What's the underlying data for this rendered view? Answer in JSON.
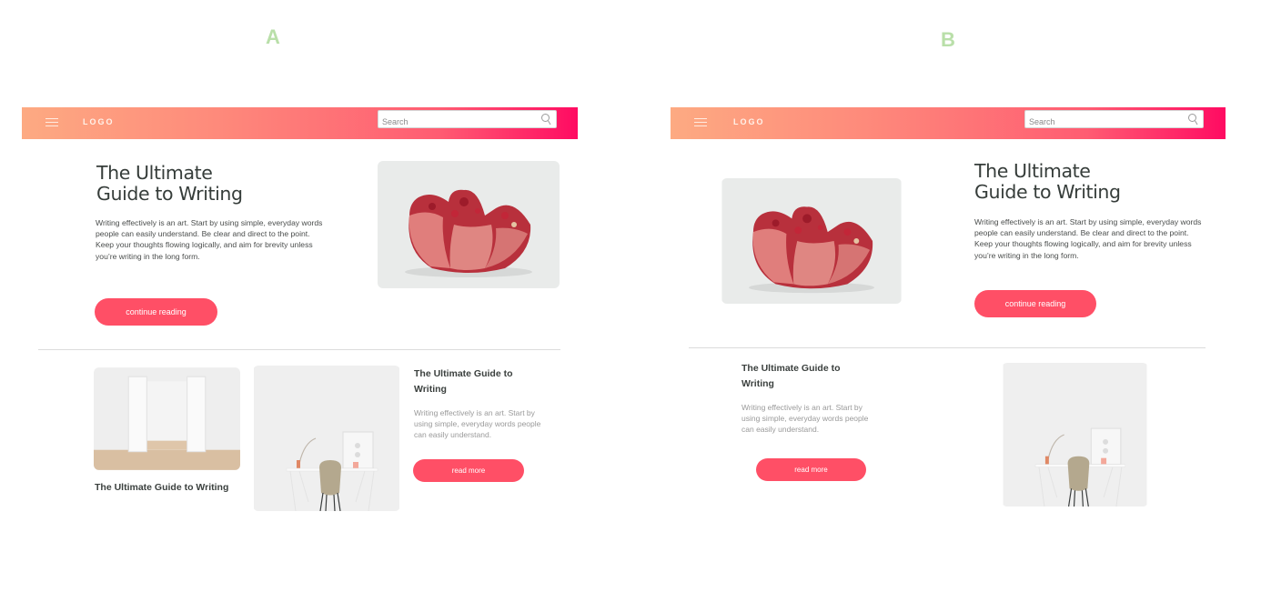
{
  "variants": {
    "a": {
      "label": "A",
      "nav": {
        "logo": "LOGO",
        "search_placeholder": "Search"
      },
      "hero": {
        "title_line1": "The Ultimate",
        "title_line2": "Guide to Writing",
        "body": "Writing effectively is an art. Start by using simple, everyday words people can easily understand. Be clear and direct to the point. Keep your thoughts flowing logically, and aim for brevity unless you’re writing in the long form.",
        "button": "continue reading",
        "image": "pomegranate-photo"
      },
      "cards": [
        {
          "title": "The Ultimate Guide to Writing",
          "image": "open-doors-room-photo"
        },
        {
          "title": "The Ultimate Guide to Writing",
          "body": "Writing effectively is an art. Start by using simple, everyday words people can easily understand.",
          "button": "read more",
          "image": "desk-chair-photo"
        }
      ]
    },
    "b": {
      "label": "B",
      "nav": {
        "logo": "LOGO",
        "search_placeholder": "Search"
      },
      "hero": {
        "title_line1": "The Ultimate",
        "title_line2": "Guide to Writing",
        "body": "Writing effectively is an art. Start by using simple, everyday words people can easily understand. Be clear and direct to the point. Keep your thoughts flowing logically, and aim for brevity unless you’re writing in the long form.",
        "button": "continue reading",
        "image": "pomegranate-photo"
      },
      "cards": [
        {
          "title": "The Ultimate Guide to Writing",
          "body": "Writing effectively is an art. Start by using simple, everyday words people can easily understand.",
          "button": "read more",
          "image": "desk-chair-photo"
        }
      ]
    }
  },
  "colors": {
    "accent": "#ff4f66",
    "nav_gradient_start": "#fdaa82",
    "nav_gradient_end": "#ff0b62",
    "variant_label": "#b9dfa9"
  }
}
